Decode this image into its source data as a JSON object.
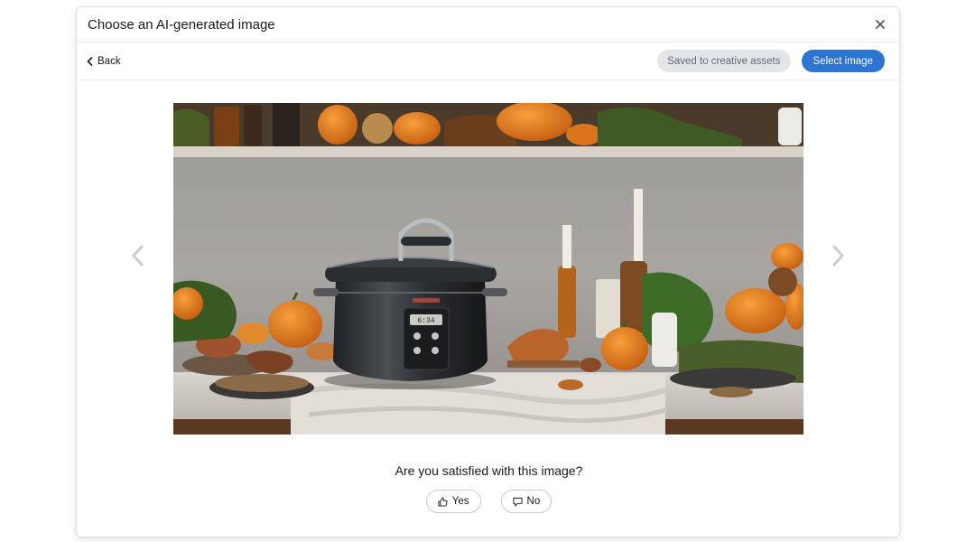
{
  "dialog": {
    "title": "Choose an AI-generated image",
    "close_icon": "close-icon"
  },
  "toolbar": {
    "back_label": "Back",
    "saved_label": "Saved to creative assets",
    "select_label": "Select image"
  },
  "viewer": {
    "prev_icon": "chevron-left-icon",
    "next_icon": "chevron-right-icon",
    "image_subject": "slow cooker on kitchen counter with autumn pumpkins",
    "display_time": "6:34"
  },
  "feedback": {
    "question": "Are you satisfied with this image?",
    "yes_label": "Yes",
    "no_label": "No"
  },
  "colors": {
    "primary": "#2c74d1",
    "secondary_bg": "#e3e6e8"
  }
}
